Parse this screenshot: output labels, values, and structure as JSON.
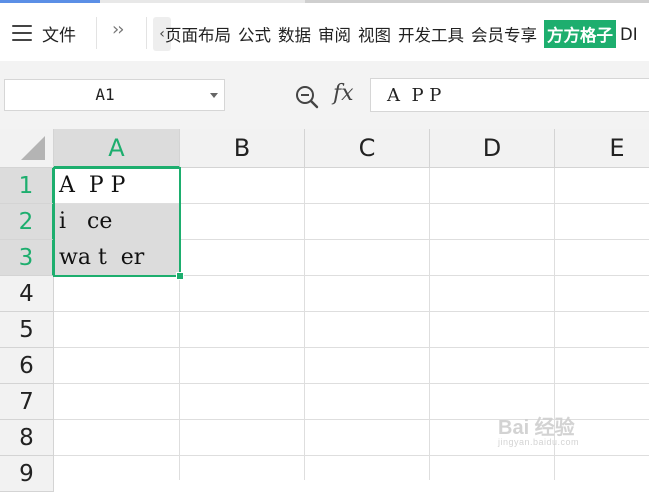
{
  "menu": {
    "file_label": "文件",
    "more_icon": "double-chevron-right",
    "scroll_left_icon": "chevron-left",
    "tabs": [
      "页面布局",
      "公式",
      "数据",
      "审阅",
      "视图",
      "开发工具",
      "会员专享",
      "方方格子",
      "DI"
    ],
    "highlight_tab_color": "#1dae6e"
  },
  "formula_bar": {
    "name_box": "A1",
    "fx_label": "fx",
    "formula_value": "A  P P"
  },
  "sheet": {
    "columns": [
      "A",
      "B",
      "C",
      "D",
      "E"
    ],
    "rows": [
      "1",
      "2",
      "3",
      "4",
      "5",
      "6",
      "7",
      "8",
      "9"
    ],
    "selected_column": "A",
    "selected_rows": [
      "1",
      "2",
      "3"
    ],
    "selection_color": "#1dae6e",
    "cells": {
      "A1": "A  P P",
      "A2": "i   ce",
      "A3": "wa t  er"
    }
  },
  "watermark": {
    "brand": "Bai 经验",
    "url": "jingyan.baidu.com"
  }
}
